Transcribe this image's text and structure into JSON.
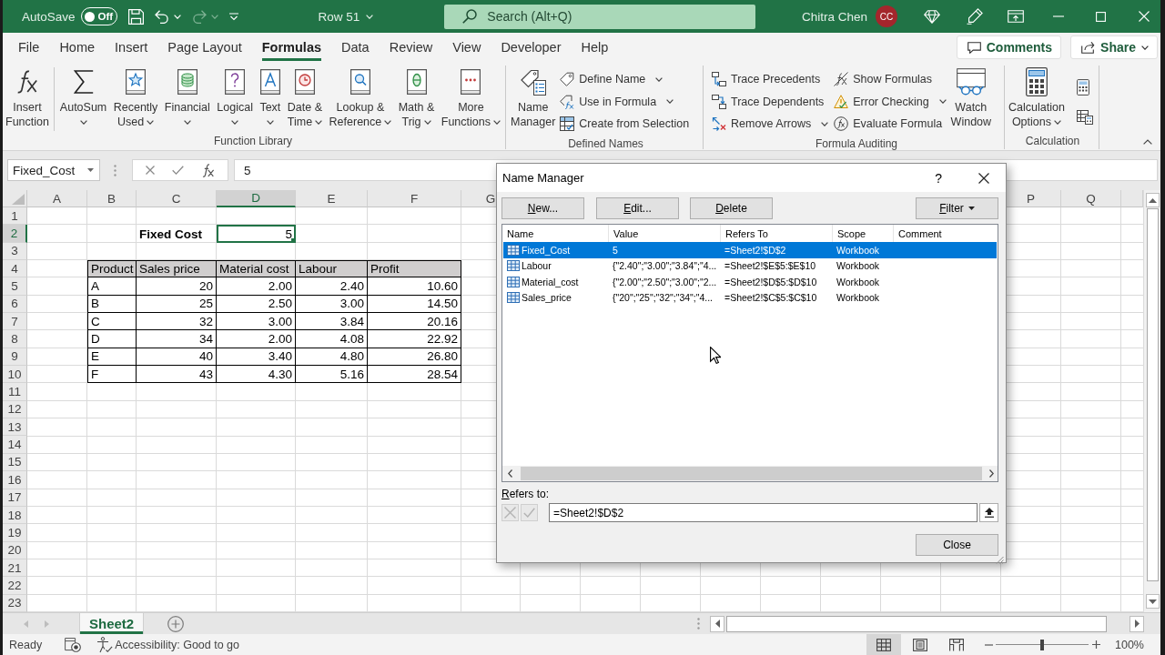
{
  "title_bar": {
    "autosave": {
      "label": "AutoSave",
      "toggle": {
        "label": "Off",
        "on": false
      }
    },
    "quick_access": [
      {
        "kind": "save",
        "disabled": false
      },
      {
        "kind": "undo",
        "disabled": false
      },
      {
        "kind": "redo",
        "disabled": true
      },
      {
        "kind": "customize",
        "disabled": false
      }
    ],
    "document_title": "Row 51",
    "search": {
      "placeholder": "Search (Alt+Q)"
    },
    "user": {
      "name": "Chitra Chen",
      "initials": "CC"
    }
  },
  "ribbon": {
    "tabs": [
      {
        "label": "File",
        "selected": false
      },
      {
        "label": "Home",
        "selected": false
      },
      {
        "label": "Insert",
        "selected": false
      },
      {
        "label": "Page Layout",
        "selected": false
      },
      {
        "label": "Formulas",
        "selected": true
      },
      {
        "label": "Data",
        "selected": false
      },
      {
        "label": "Review",
        "selected": false
      },
      {
        "label": "View",
        "selected": false
      },
      {
        "label": "Developer",
        "selected": false
      },
      {
        "label": "Help",
        "selected": false
      }
    ],
    "actions": [
      {
        "kind": "comments",
        "label": "Comments",
        "dropdown": false
      },
      {
        "kind": "share",
        "label": "Share",
        "dropdown": true
      }
    ],
    "groups": [
      {
        "label": "Function Library",
        "items": [
          {
            "kind": "large",
            "label": "Insert\nFunction",
            "dropdown": false
          },
          {
            "kind": "separator"
          },
          {
            "kind": "large",
            "label": "AutoSum",
            "dropdown": true
          },
          {
            "kind": "large",
            "label": "Recently\nUsed",
            "dropdown": true
          },
          {
            "kind": "large",
            "label": "Financial",
            "dropdown": true
          },
          {
            "kind": "large",
            "label": "Logical",
            "dropdown": true
          },
          {
            "kind": "large",
            "label": "Text",
            "dropdown": true
          },
          {
            "kind": "large",
            "label": "Date &\nTime",
            "dropdown": true
          },
          {
            "kind": "large",
            "label": "Lookup &\nReference",
            "dropdown": true
          },
          {
            "kind": "large",
            "label": "Math &\nTrig",
            "dropdown": true
          },
          {
            "kind": "large",
            "label": "More\nFunctions",
            "dropdown": true
          }
        ]
      },
      {
        "label": "Defined Names",
        "items": [
          {
            "kind": "large",
            "label": "Name\nManager",
            "dropdown": false
          },
          {
            "kind": "stack",
            "items": [
              {
                "label": "Define Name",
                "dropdown": true
              },
              {
                "label": "Use in Formula",
                "dropdown": true
              },
              {
                "label": "Create from Selection",
                "dropdown": false
              }
            ]
          }
        ]
      },
      {
        "label": "Formula Auditing",
        "items": [
          {
            "kind": "stack",
            "items": [
              {
                "label": "Trace Precedents",
                "dropdown": false
              },
              {
                "label": "Trace Dependents",
                "dropdown": false
              },
              {
                "label": "Remove Arrows",
                "dropdown": true
              }
            ]
          },
          {
            "kind": "stack",
            "items": [
              {
                "label": "Show Formulas",
                "dropdown": false
              },
              {
                "label": "Error Checking",
                "dropdown": true
              },
              {
                "label": "Evaluate Formula",
                "dropdown": false
              }
            ]
          },
          {
            "kind": "large",
            "label": "Watch\nWindow",
            "dropdown": false
          }
        ]
      },
      {
        "label": "Calculation",
        "items": [
          {
            "kind": "large",
            "label": "Calculation\nOptions",
            "dropdown": true
          },
          {
            "kind": "icon_stack",
            "items": [
              {
                "kind": "calculate_now"
              },
              {
                "kind": "calculate_sheet"
              }
            ]
          }
        ]
      }
    ]
  },
  "formula_bar": {
    "name_box": "Fixed_Cost",
    "formula": "5"
  },
  "sheet": {
    "columns": [
      {
        "label": "A",
        "selected": false
      },
      {
        "label": "B",
        "selected": false
      },
      {
        "label": "C",
        "selected": false
      },
      {
        "label": "D",
        "selected": true
      },
      {
        "label": "E",
        "selected": false
      },
      {
        "label": "F",
        "selected": false
      },
      {
        "label": "G",
        "selected": false
      },
      {
        "label": "P",
        "selected": false
      },
      {
        "label": "Q",
        "selected": false
      }
    ],
    "rows": [
      {
        "label": "1",
        "selected": false
      },
      {
        "label": "2",
        "selected": true
      },
      {
        "label": "3",
        "selected": false
      },
      {
        "label": "4",
        "selected": false
      },
      {
        "label": "5",
        "selected": false
      },
      {
        "label": "6",
        "selected": false
      },
      {
        "label": "7",
        "selected": false
      },
      {
        "label": "8",
        "selected": false
      },
      {
        "label": "9",
        "selected": false
      },
      {
        "label": "10",
        "selected": false
      },
      {
        "label": "11",
        "selected": false
      },
      {
        "label": "12",
        "selected": false
      },
      {
        "label": "13",
        "selected": false
      },
      {
        "label": "14",
        "selected": false
      },
      {
        "label": "15",
        "selected": false
      },
      {
        "label": "16",
        "selected": false
      },
      {
        "label": "17",
        "selected": false
      },
      {
        "label": "18",
        "selected": false
      },
      {
        "label": "19",
        "selected": false
      },
      {
        "label": "20",
        "selected": false
      },
      {
        "label": "21",
        "selected": false
      },
      {
        "label": "22",
        "selected": false
      },
      {
        "label": "23",
        "selected": false
      }
    ],
    "label_cell": {
      "text": "Fixed Cost"
    },
    "active_cell": {
      "text": "5",
      "selected": true
    },
    "table": {
      "columns": [
        "Product",
        "Sales price",
        "Material cost",
        "Labour",
        "Profit"
      ],
      "rows": [
        [
          "A",
          "20",
          "2.00",
          "2.40",
          "10.60"
        ],
        [
          "B",
          "25",
          "2.50",
          "3.00",
          "14.50"
        ],
        [
          "C",
          "32",
          "3.00",
          "3.84",
          "20.16"
        ],
        [
          "D",
          "34",
          "2.00",
          "4.08",
          "22.92"
        ],
        [
          "E",
          "40",
          "3.40",
          "4.80",
          "26.80"
        ],
        [
          "F",
          "43",
          "4.30",
          "5.16",
          "28.54"
        ]
      ]
    }
  },
  "sheet_tabs": [
    {
      "label": "Sheet2",
      "selected": true
    }
  ],
  "status_bar": {
    "mode": "Ready",
    "accessibility": "Accessibility: Good to go",
    "views": [
      {
        "kind": "normal",
        "selected": true
      },
      {
        "kind": "page_layout",
        "selected": false
      },
      {
        "kind": "page_break",
        "selected": false
      }
    ],
    "zoom": {
      "level": 0.5,
      "reading": "100%"
    }
  },
  "name_manager": {
    "title": "Name Manager",
    "help": "?",
    "buttons": [
      {
        "label": "New...",
        "mnemonic": true
      },
      {
        "label": "Edit...",
        "mnemonic": true
      },
      {
        "label": "Delete",
        "mnemonic": true
      }
    ],
    "filter": {
      "label": "Filter",
      "mnemonic": true
    },
    "columns": [
      "Name",
      "Value",
      "Refers To",
      "Scope",
      "Comment"
    ],
    "names": [
      {
        "name": "Fixed_Cost",
        "value": "5",
        "refers_to": "=Sheet2!$D$2",
        "scope": "Workbook",
        "selected": true
      },
      {
        "name": "Labour",
        "value": "{\"2.40\";\"3.00\";\"3.84\";\"4...",
        "refers_to": "=Sheet2!$E$5:$E$10",
        "scope": "Workbook",
        "selected": false
      },
      {
        "name": "Material_cost",
        "value": "{\"2.00\";\"2.50\";\"3.00\";\"2...",
        "refers_to": "=Sheet2!$D$5:$D$10",
        "scope": "Workbook",
        "selected": false
      },
      {
        "name": "Sales_price",
        "value": "{\"20\";\"25\";\"32\";\"34\";\"4...",
        "refers_to": "=Sheet2!$C$5:$C$10",
        "scope": "Workbook",
        "selected": false
      }
    ],
    "refers_to": {
      "label": "Refers to:",
      "mnemonic": true,
      "value": "=Sheet2!$D$2"
    },
    "entry_buttons": [
      {
        "kind": "cancel",
        "disabled": true
      },
      {
        "kind": "accept",
        "disabled": true
      }
    ],
    "close": "Close"
  }
}
